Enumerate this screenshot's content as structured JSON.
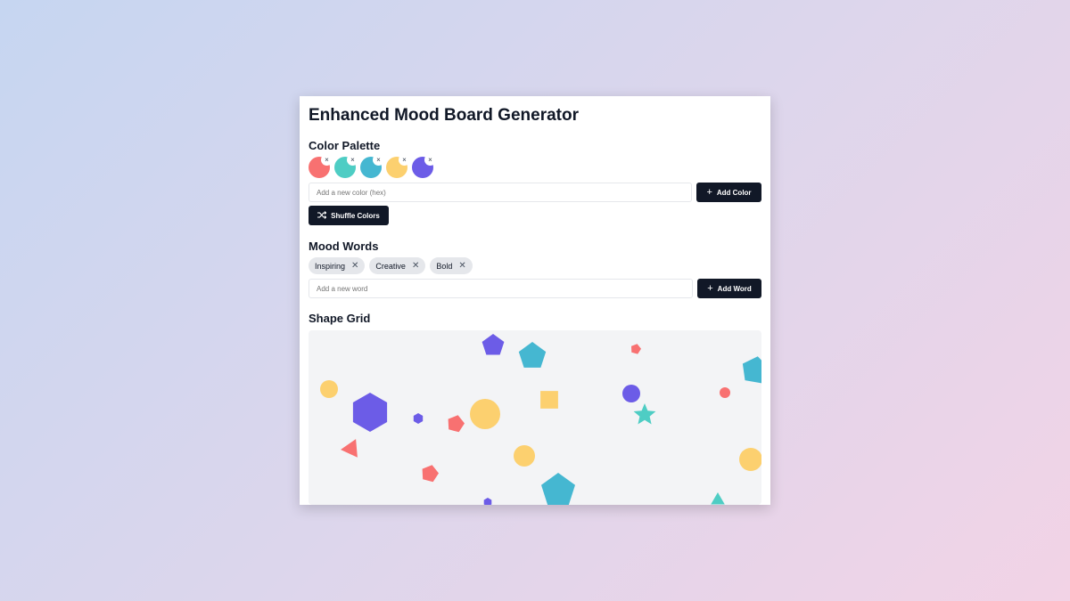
{
  "app": {
    "title": "Enhanced Mood Board Generator"
  },
  "palette": {
    "heading": "Color Palette",
    "colors": [
      "#f87171",
      "#4ecdc4",
      "#45b7d1",
      "#fcd06f",
      "#6c5ce7"
    ],
    "remove_glyph": "×",
    "input_placeholder": "Add a new color (hex)",
    "add_label": "Add Color",
    "shuffle_label": "Shuffle Colors"
  },
  "words": {
    "heading": "Mood Words",
    "items": [
      "Inspiring",
      "Creative",
      "Bold"
    ],
    "remove_glyph": "✕",
    "input_placeholder": "Add a new word",
    "add_label": "Add Word"
  },
  "grid": {
    "heading": "Shape Grid",
    "background": "#f3f4f6",
    "shapes": [
      {
        "type": "circle",
        "color": "#fcd06f"
      },
      {
        "type": "hexagon",
        "color": "#6c5ce7"
      },
      {
        "type": "hexagon",
        "color": "#6c5ce7"
      },
      {
        "type": "pentagon",
        "color": "#f87171"
      },
      {
        "type": "circle",
        "color": "#fcd06f"
      },
      {
        "type": "triangle",
        "color": "#f87171"
      },
      {
        "type": "circle",
        "color": "#fcd06f"
      },
      {
        "type": "pentagon",
        "color": "#f87171"
      },
      {
        "type": "pentagon",
        "color": "#45b7d1"
      },
      {
        "type": "pentagon",
        "color": "#6c5ce7"
      },
      {
        "type": "pentagon",
        "color": "#45b7d1"
      },
      {
        "type": "square",
        "color": "#fcd06f"
      },
      {
        "type": "pentagon",
        "color": "#f87171"
      },
      {
        "type": "circle",
        "color": "#6c5ce7"
      },
      {
        "type": "star",
        "color": "#4ecdc4"
      },
      {
        "type": "circle",
        "color": "#f87171"
      },
      {
        "type": "pentagon",
        "color": "#45b7d1"
      },
      {
        "type": "circle",
        "color": "#fcd06f"
      },
      {
        "type": "triangle",
        "color": "#4ecdc4"
      },
      {
        "type": "hexagon",
        "color": "#6c5ce7"
      }
    ]
  }
}
